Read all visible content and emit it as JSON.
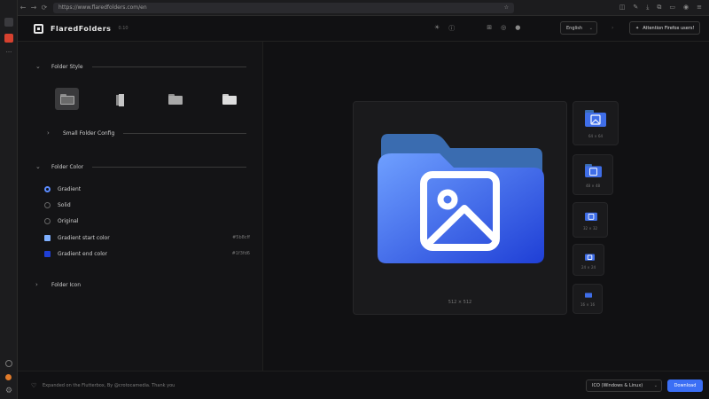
{
  "browser": {
    "url": "https://www.flaredfolders.com/en",
    "nav": {
      "back": "←",
      "forward": "→",
      "reload": "⟳"
    }
  },
  "header": {
    "brand": "FlaredFolders",
    "version": "0.10",
    "language": "English",
    "attention_button": "Attention Firefox users!"
  },
  "folder_style": {
    "title": "Folder Style",
    "small_folder_config": "Small Folder Config",
    "options": [
      "folder-dark",
      "folder-door",
      "folder-gray",
      "folder-light"
    ],
    "selected": 0
  },
  "folder_color": {
    "title": "Folder Color",
    "modes": [
      "Gradient",
      "Solid",
      "Original"
    ],
    "selected_mode": "Gradient",
    "gradient_start_label": "Gradient start color",
    "gradient_start_hex": "#5b8cff",
    "gradient_end_label": "Gradient end color",
    "gradient_end_hex": "#1f3fd6"
  },
  "folder_icon": {
    "title": "Folder Icon"
  },
  "preview": {
    "main_caption": "512 × 512",
    "thumbs": [
      "64 × 64",
      "48 × 48",
      "32 × 32",
      "24 × 24",
      "16 × 16"
    ]
  },
  "footer": {
    "text": "Expanded on the Flutterbox, By @crotocamedia. Thank you",
    "format": "ICO (Windows & Linux)",
    "download": "Download"
  },
  "colors": {
    "accent": "#3b6ff5",
    "folder_light": "#6fa0ff",
    "folder_dark": "#1f3fd6",
    "folder_tab": "#3a6cb0"
  }
}
